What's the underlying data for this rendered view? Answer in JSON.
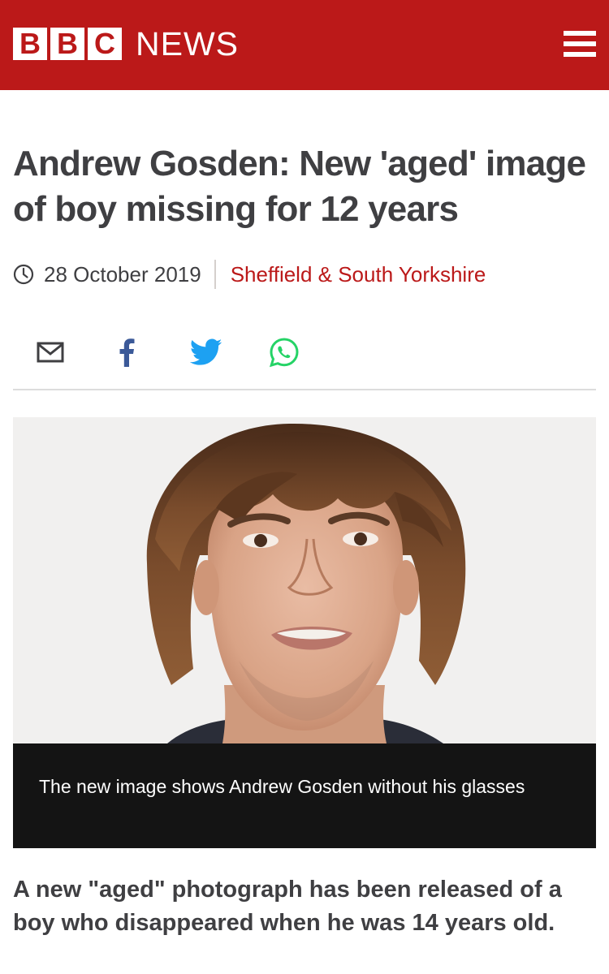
{
  "header": {
    "logo_letters": [
      "B",
      "B",
      "C"
    ],
    "news_label": "NEWS",
    "brand_color": "#bb1919"
  },
  "article": {
    "headline": "Andrew Gosden: New 'aged' image of boy missing for 12 years",
    "date": "28 October 2019",
    "section": "Sheffield & South Yorkshire",
    "share_icons": [
      "email-icon",
      "facebook-icon",
      "twitter-icon",
      "whatsapp-icon"
    ],
    "image_caption": "The new image shows Andrew Gosden without his glasses",
    "intro": "A new \"aged\" photograph has been released of a boy who disappeared when he was 14 years old."
  }
}
